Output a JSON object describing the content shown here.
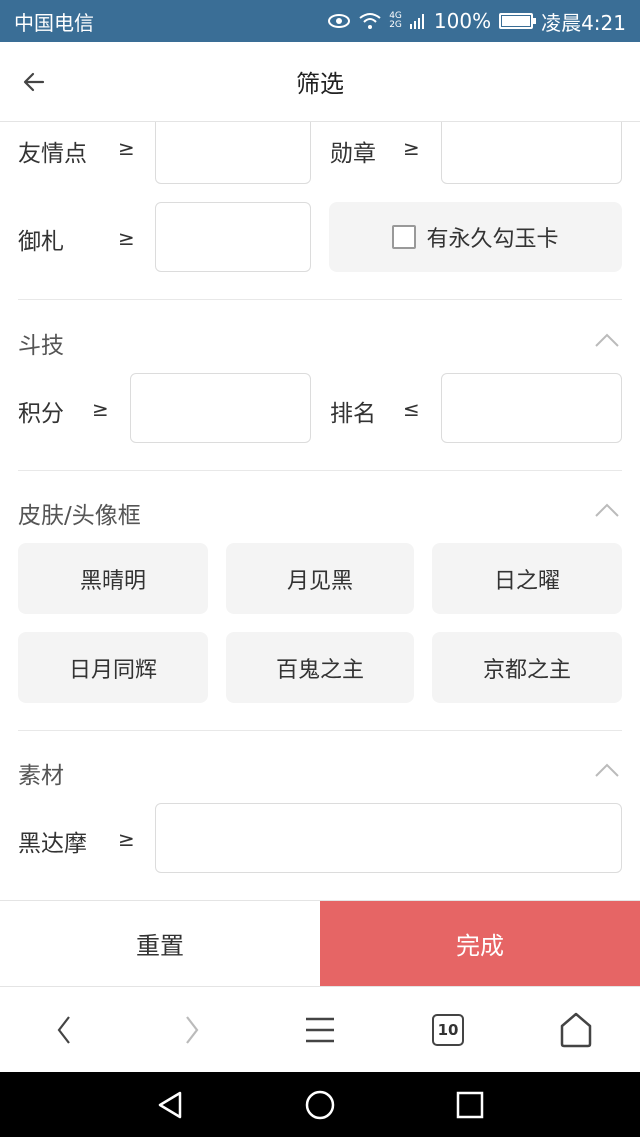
{
  "status_bar": {
    "carrier": "中国电信",
    "network": "4G",
    "network2": "2G",
    "battery_percent": "100%",
    "battery_level": 1.0,
    "time": "凌晨4:21"
  },
  "header": {
    "title": "筛选"
  },
  "top_fields": {
    "friendship": {
      "label": "友情点",
      "op": "≥"
    },
    "medal": {
      "label": "勋章",
      "op": "≥"
    },
    "amulet": {
      "label": "御札",
      "op": "≥"
    },
    "permanent_card": "有永久勾玉卡"
  },
  "section_duel": {
    "title": "斗技",
    "score": {
      "label": "积分",
      "op": "≥"
    },
    "rank": {
      "label": "排名",
      "op": "≤"
    }
  },
  "section_skin": {
    "title": "皮肤/头像框",
    "chips": [
      "黑晴明",
      "月见黑",
      "日之曜",
      "日月同辉",
      "百鬼之主",
      "京都之主"
    ]
  },
  "section_material": {
    "title": "素材",
    "black_daruma": {
      "label": "黑达摩",
      "op": "≥"
    }
  },
  "actions": {
    "reset": "重置",
    "done": "完成"
  },
  "browser_bar": {
    "tab_count": "10"
  }
}
